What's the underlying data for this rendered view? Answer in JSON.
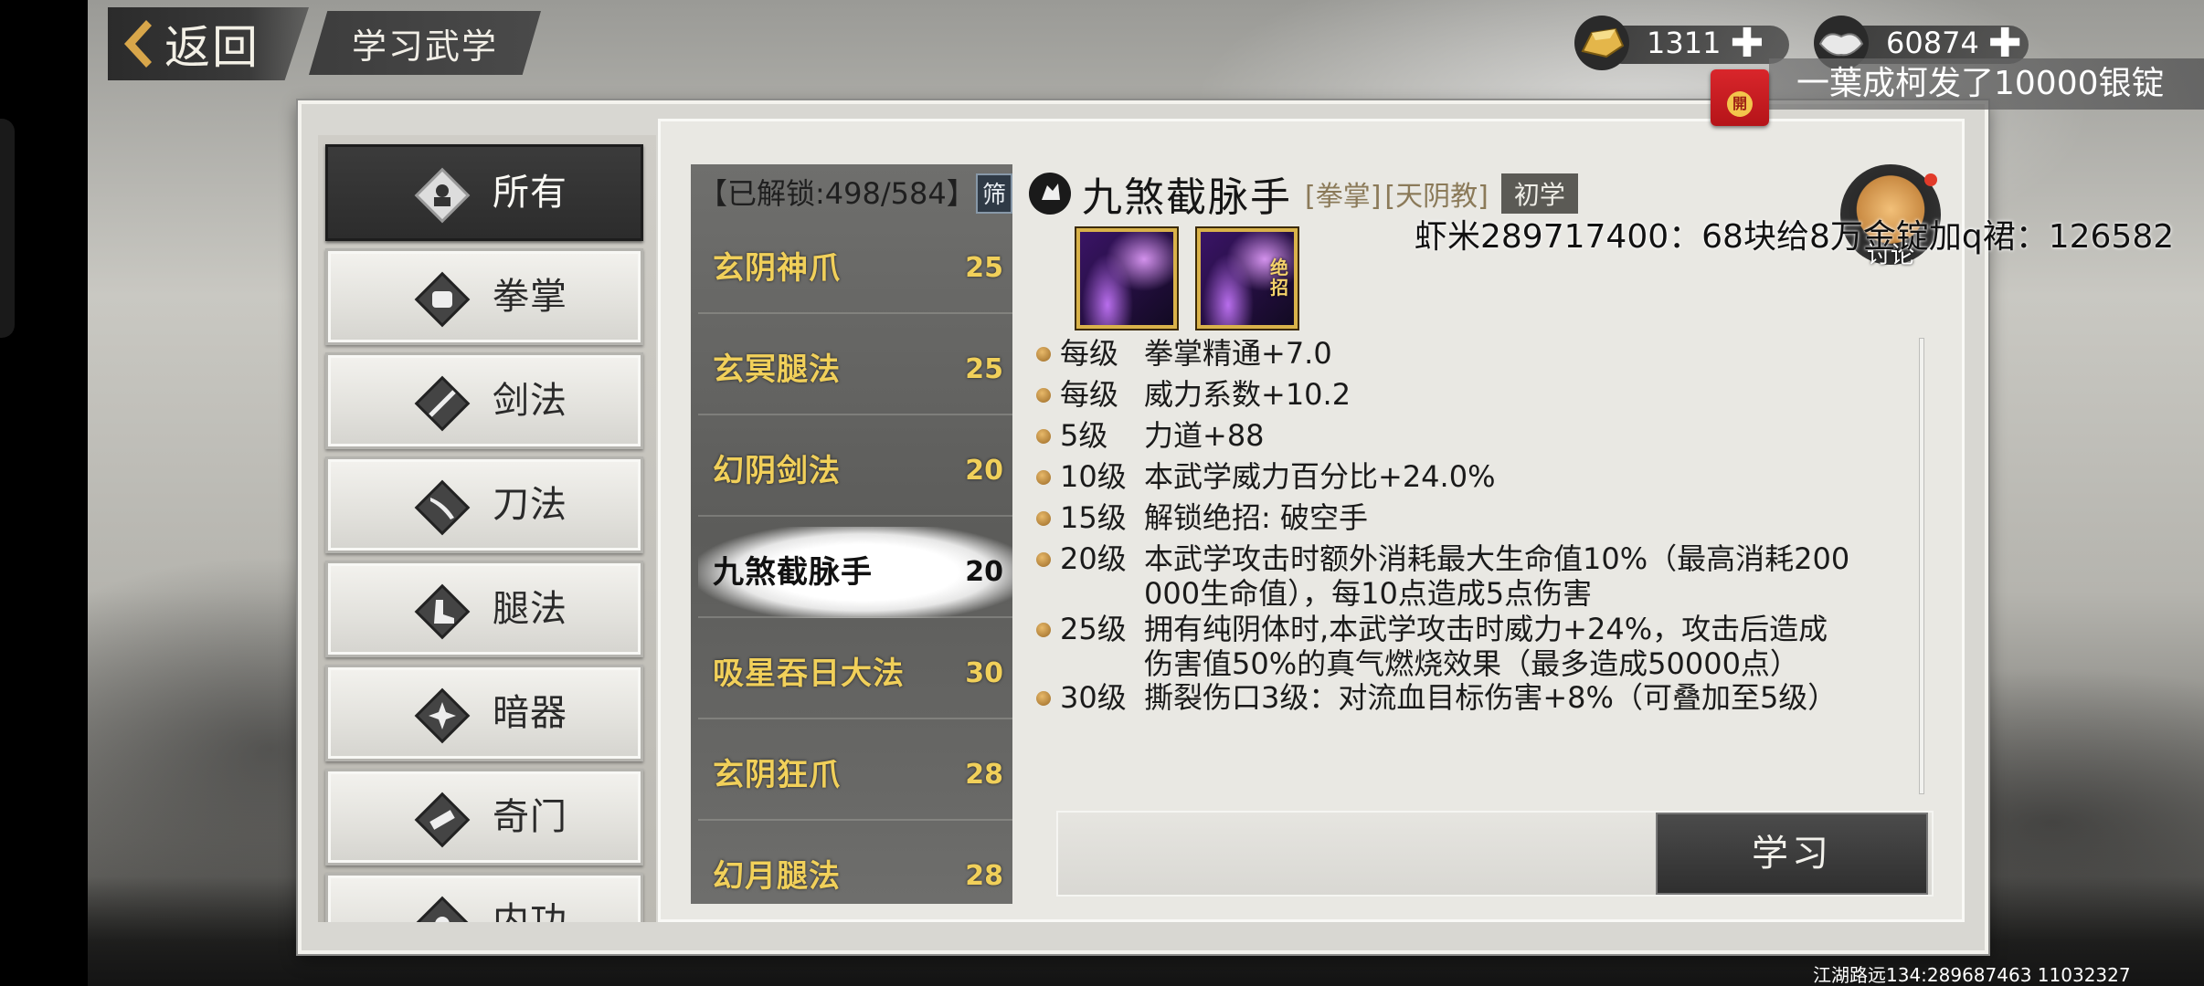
{
  "header": {
    "back_label": "返回",
    "title": "学习武学"
  },
  "currency": {
    "gold_value": "1311",
    "silver_value": "60874",
    "plus": "✚"
  },
  "broadcast": {
    "text": "一葉成柯发了10000银锭",
    "red_packet_label": "開"
  },
  "categories": [
    {
      "label": "所有",
      "icon": "all-icon",
      "active": true
    },
    {
      "label": "拳掌",
      "icon": "fist-icon"
    },
    {
      "label": "剑法",
      "icon": "sword-icon"
    },
    {
      "label": "刀法",
      "icon": "blade-icon"
    },
    {
      "label": "腿法",
      "icon": "boot-icon"
    },
    {
      "label": "暗器",
      "icon": "shuriken-icon"
    },
    {
      "label": "奇门",
      "icon": "scroll-icon"
    },
    {
      "label": "内功",
      "icon": "inner-icon"
    }
  ],
  "list": {
    "unlock_text": "【已解锁:498/584】",
    "filter_label": "筛",
    "items": [
      {
        "name": "玄阴神爪",
        "level": "25"
      },
      {
        "name": "玄冥腿法",
        "level": "25"
      },
      {
        "name": "幻阴剑法",
        "level": "20"
      },
      {
        "name": "九煞截脉手",
        "level": "20",
        "selected": true
      },
      {
        "name": "吸星吞日大法",
        "level": "30"
      },
      {
        "name": "玄阴狂爪",
        "level": "28"
      },
      {
        "name": "幻月腿法",
        "level": "28"
      }
    ]
  },
  "detail": {
    "name": "九煞截脉手",
    "type_tag": "[拳掌]",
    "sect_tag": "[天阴教]",
    "rank": "初学",
    "ult_label": "绝招",
    "discuss_label": "讨论",
    "effects": [
      {
        "level": "每级",
        "desc": "拳掌精通+7.0"
      },
      {
        "level": "每级",
        "desc": "威力系数+10.2"
      },
      {
        "level": "5级",
        "desc": "力道+88"
      },
      {
        "level": "10级",
        "desc": "本武学威力百分比+24.0%"
      },
      {
        "level": "15级",
        "desc": "解锁绝招:  破空手"
      },
      {
        "level": "20级",
        "desc": "本武学攻击时额外消耗最大生命值10%（最高消耗200\n000生命值），每10点造成5点伤害"
      },
      {
        "level": "25级",
        "desc": "拥有纯阴体时,本武学攻击时威力+24%，攻击后造成\n伤害值50%的真气燃烧效果（最多造成50000点）"
      },
      {
        "level": "30级",
        "desc": "撕裂伤口3级：对流血目标伤害+8%（可叠加至5级）"
      }
    ],
    "learn_label": "学习"
  },
  "overlay_message": "虾米289717400：68块给8万金锭加q裙：126582",
  "footer_id": "江湖路远134:289687463  11032327",
  "colors": {
    "accent_gold": "#f1d05a",
    "dark_button": "#2f2f2f"
  }
}
